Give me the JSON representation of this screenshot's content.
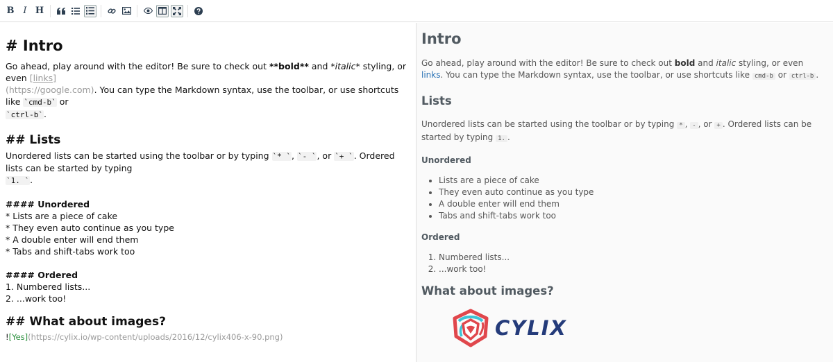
{
  "toolbar": {
    "buttons": [
      {
        "name": "bold-button",
        "label": "B"
      },
      {
        "name": "italic-button",
        "label": "I"
      },
      {
        "name": "heading-button",
        "label": "H"
      },
      {
        "name": "quote-button",
        "icon": "quote-icon"
      },
      {
        "name": "unordered-list-button",
        "icon": "unordered-list-icon"
      },
      {
        "name": "ordered-list-button",
        "icon": "ordered-list-icon"
      },
      {
        "name": "link-button",
        "icon": "link-icon"
      },
      {
        "name": "image-button",
        "icon": "image-icon"
      },
      {
        "name": "preview-button",
        "icon": "eye-icon"
      },
      {
        "name": "side-by-side-button",
        "icon": "columns-icon"
      },
      {
        "name": "fullscreen-button",
        "icon": "fullscreen-icon"
      },
      {
        "name": "guide-button",
        "icon": "help-icon"
      }
    ]
  },
  "editor": {
    "h_intro": "# Intro",
    "intro_1": "Go ahead, play around with the editor! Be sure to check out ",
    "intro_bold": "**bold**",
    "intro_2": " and ",
    "intro_italic": "*italic*",
    "intro_3": " styling, or even ",
    "intro_link_text": "[links]",
    "intro_link_url": "(https://google.com)",
    "intro_4": ". You can type the Markdown syntax, use the toolbar, or use shortcuts like ",
    "intro_code1": "`cmd-b`",
    "intro_5": " or ",
    "intro_code2": "`ctrl-b`",
    "intro_6": ".",
    "h_lists": "## Lists",
    "lists_1": "Unordered lists can be started using the toolbar or by typing ",
    "lists_code1": "`* `",
    "lists_sep1": ", ",
    "lists_code2": "`- `",
    "lists_sep2": ", or ",
    "lists_code3": "`+ `",
    "lists_2": ". Ordered lists can be started by typing ",
    "lists_code4": "`1. `",
    "lists_3": ".",
    "h_unordered": "#### Unordered",
    "unordered": [
      "* Lists are a piece of cake",
      "* They even auto continue as you type",
      "* A double enter will end them",
      "* Tabs and shift-tabs work too"
    ],
    "h_ordered": "#### Ordered",
    "ordered": [
      "1. Numbered lists...",
      "2. ...work too!"
    ],
    "h_images": "## What about images?",
    "img_prefix": "!",
    "img_alt": "[Yes]",
    "img_url": "(https://cylix.io/wp-content/uploads/2016/12/cylix406-x-90.png)"
  },
  "preview": {
    "h_intro": "Intro",
    "intro_1": "Go ahead, play around with the editor! Be sure to check out ",
    "intro_bold": "bold",
    "intro_2": " and ",
    "intro_italic": "italic",
    "intro_3": " styling, or even ",
    "intro_link": "links",
    "intro_4": ". You can type the Markdown syntax, use the toolbar, or use shortcuts like ",
    "intro_code1": "cmd-b",
    "intro_5": " or ",
    "intro_code2": "ctrl-b",
    "intro_6": ".",
    "h_lists": "Lists",
    "lists_1": "Unordered lists can be started using the toolbar or by typing ",
    "lists_code1": "*",
    "lists_sep1": ", ",
    "lists_code2": "-",
    "lists_sep2": ", or ",
    "lists_code3": "+",
    "lists_2": ". Ordered lists can be started by typing ",
    "lists_code4": "1.",
    "lists_3": ".",
    "h_unordered": "Unordered",
    "unordered": [
      "Lists are a piece of cake",
      "They even auto continue as you type",
      "A double enter will end them",
      "Tabs and shift-tabs work too"
    ],
    "h_ordered": "Ordered",
    "ordered": [
      "Numbered lists...",
      "...work too!"
    ],
    "h_images": "What about images?",
    "logo_text": "CYLIX"
  },
  "colors": {
    "accent_link": "#2a72b5",
    "heading": "#515a61",
    "logo_blue": "#243b7a",
    "logo_red": "#e0474c"
  }
}
